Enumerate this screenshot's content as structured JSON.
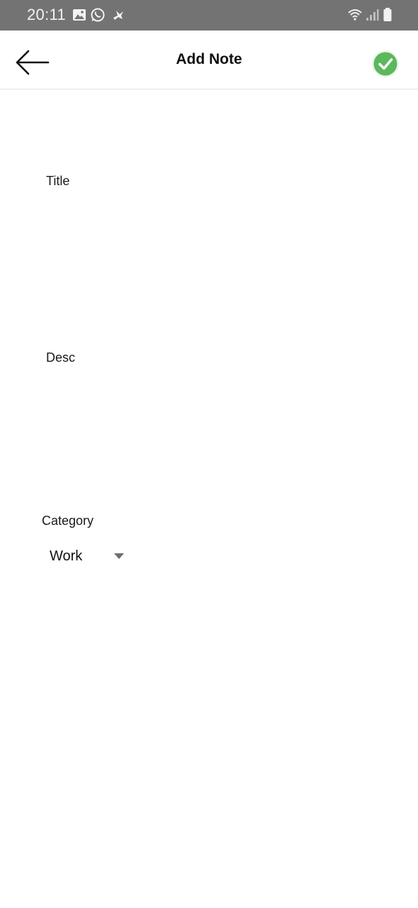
{
  "status_bar": {
    "time": "20:11",
    "icons": [
      "gallery-icon",
      "whatsapp-icon",
      "bird-icon",
      "wifi-icon",
      "signal-icon",
      "battery-icon"
    ]
  },
  "app_bar": {
    "title": "Add Note",
    "back_icon": "back-arrow-icon",
    "save_icon": "check-icon",
    "save_color": "#5cb85c"
  },
  "form": {
    "title": {
      "label": "Title",
      "value": ""
    },
    "desc": {
      "label": "Desc",
      "value": ""
    },
    "category": {
      "label": "Category",
      "selected": "Work"
    }
  }
}
